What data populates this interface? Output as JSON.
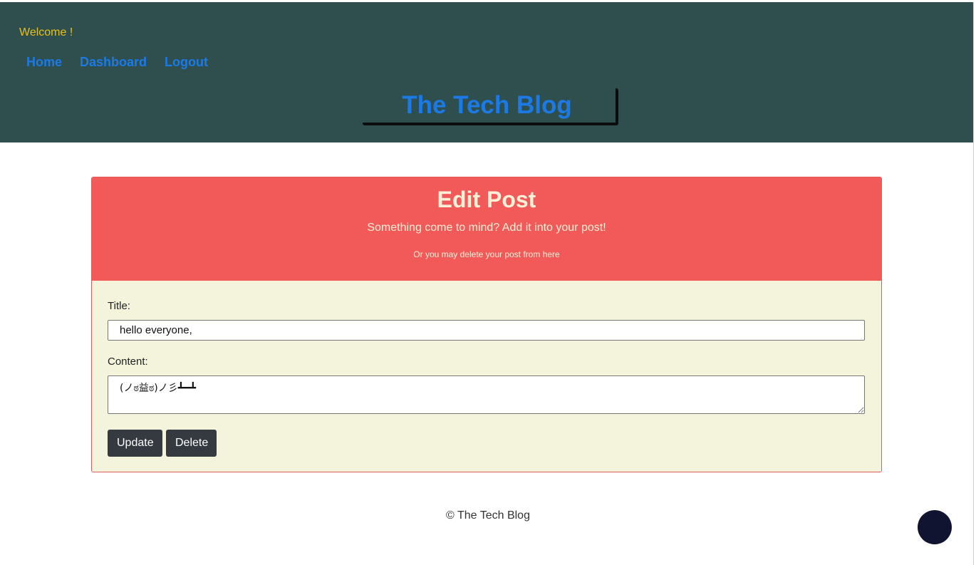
{
  "header": {
    "welcome": "Welcome !",
    "nav": {
      "home": "Home",
      "dashboard": "Dashboard",
      "logout": "Logout"
    },
    "site_title": "The Tech Blog"
  },
  "edit_post": {
    "title": "Edit Post",
    "subtitle": "Something come to mind? Add it into your post!",
    "note": "Or you may delete your post from here",
    "form": {
      "title_label": "Title:",
      "title_value": "hello everyone,",
      "content_label": "Content:",
      "content_value": "(ノಠ益ಠ)ノ彡┻━┻",
      "update_label": "Update",
      "delete_label": "Delete"
    }
  },
  "footer": {
    "copyright": "© The Tech Blog"
  },
  "colors": {
    "header_bg": "#2f4f4f",
    "link": "#1c7ae6",
    "welcome": "#e7c11a",
    "card_head": "#f25a5a",
    "card_body": "#f4f3dc",
    "button": "#343a40"
  }
}
